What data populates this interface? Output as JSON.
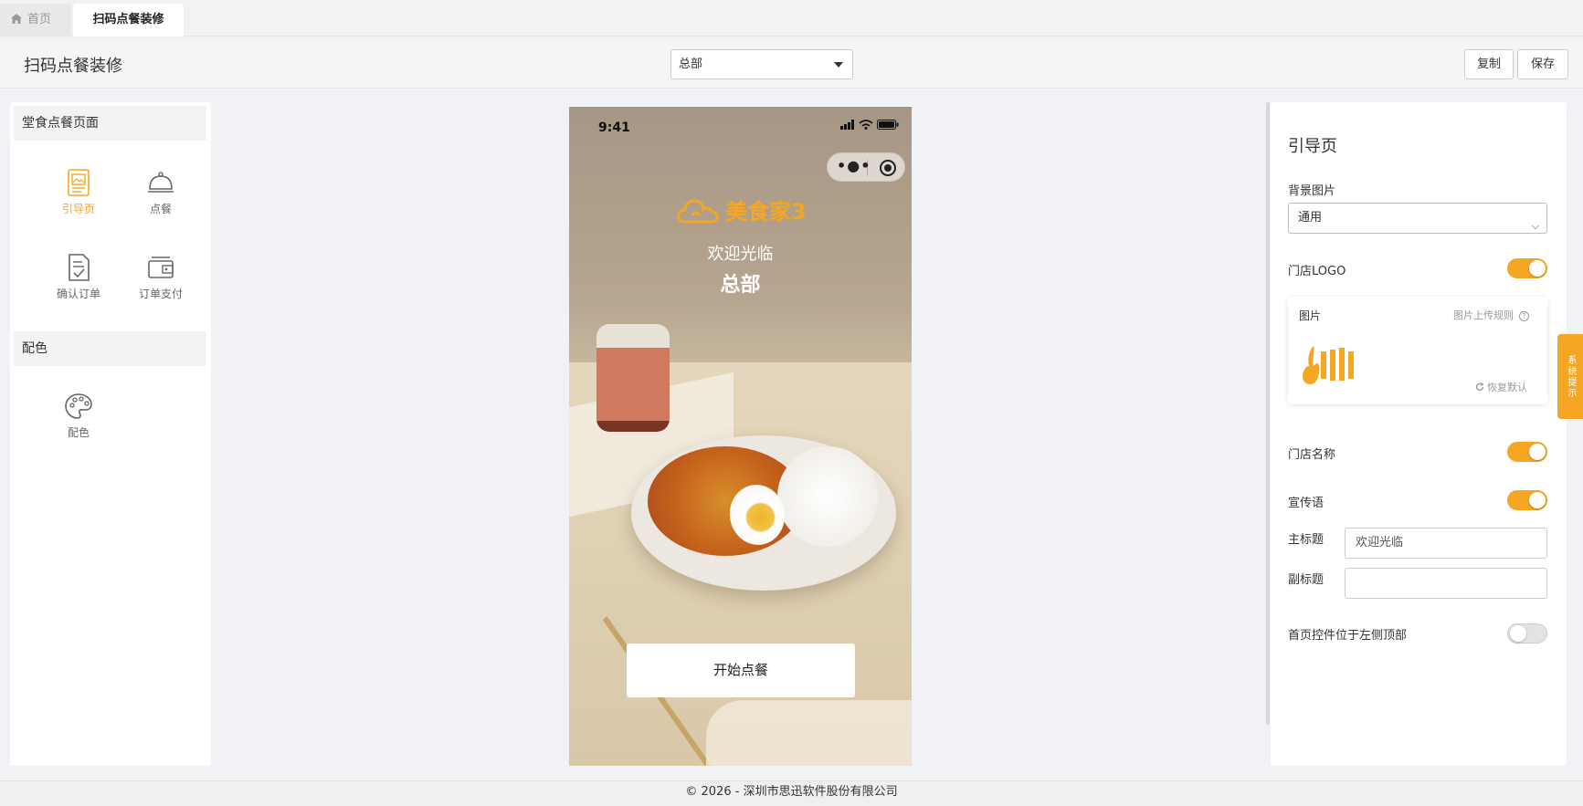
{
  "tabs": {
    "home": "首页",
    "active": "扫码点餐装修"
  },
  "header": {
    "title": "扫码点餐装修",
    "store_select": "总部",
    "copy_label": "复制",
    "save_label": "保存"
  },
  "left_panel": {
    "section1": "堂食点餐页面",
    "components": [
      {
        "label": "引导页",
        "icon": "guide-page-icon"
      },
      {
        "label": "点餐",
        "icon": "cloche-icon"
      },
      {
        "label": "确认订单",
        "icon": "order-confirm-icon"
      },
      {
        "label": "订单支付",
        "icon": "wallet-icon"
      }
    ],
    "section2": "配色",
    "color_component": {
      "label": "配色",
      "icon": "palette-icon"
    }
  },
  "phone": {
    "time": "9:41",
    "brand": "美食家3",
    "welcome": "欢迎光临",
    "store_name": "总部",
    "start_button": "开始点餐"
  },
  "right_panel": {
    "title": "引导页",
    "bg_label": "背景图片",
    "bg_value": "通用",
    "logo_label": "门店LOGO",
    "logo_on": true,
    "image_label": "图片",
    "upload_rule": "图片上传规则",
    "reset_label": "恢复默认",
    "store_name_label": "门店名称",
    "store_name_on": true,
    "slogan_label": "宣传语",
    "slogan_on": true,
    "main_title_label": "主标题",
    "main_title_value": "欢迎光临",
    "sub_title_label": "副标题",
    "sub_title_value": "",
    "top_left_label": "首页控件位于左侧顶部",
    "top_left_on": false
  },
  "system_tip": "系统提示",
  "footer": "© 2026 - 深圳市思迅软件股份有限公司",
  "colors": {
    "accent": "#f5a623"
  }
}
